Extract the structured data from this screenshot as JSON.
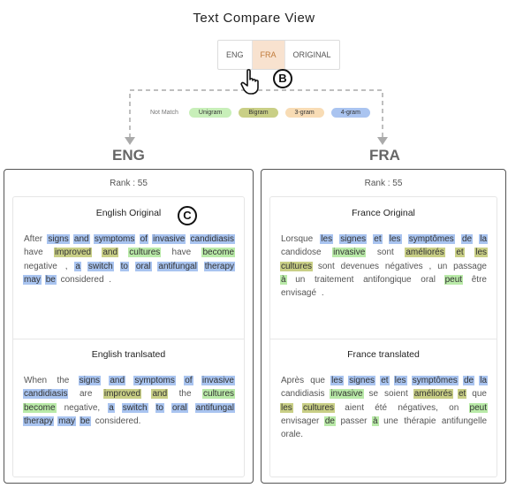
{
  "title": "Text Compare View",
  "tabs": [
    {
      "label": "ENG",
      "active": false
    },
    {
      "label": "FRA",
      "active": true
    },
    {
      "label": "ORIGINAL",
      "active": false
    }
  ],
  "annotations": {
    "b": "B",
    "c": "C"
  },
  "legend": {
    "not_match": "Not Match",
    "items": [
      {
        "label": "Unigram",
        "color": "#c8efb9"
      },
      {
        "label": "Bigram",
        "color": "#c9cf86"
      },
      {
        "label": "3-gram",
        "color": "#f8dcb5"
      },
      {
        "label": "4-gram",
        "color": "#aac4f0"
      }
    ]
  },
  "side_labels": {
    "eng": "ENG",
    "fra": "FRA"
  },
  "panels": {
    "eng": {
      "rank": "Rank : 55",
      "original_title": "English Original",
      "translated_title": "English tranlsated",
      "original": [
        [
          "After",
          ""
        ],
        [
          "signs",
          "u"
        ],
        [
          "and",
          "u"
        ],
        [
          "symptoms",
          "u"
        ],
        [
          "of",
          "u"
        ],
        [
          "invasive",
          "u"
        ],
        [
          "candidiasis",
          "u"
        ],
        [
          "have",
          ""
        ],
        [
          "improved",
          "b"
        ],
        [
          "and",
          "b"
        ],
        [
          "cultures",
          "g"
        ],
        [
          "have",
          ""
        ],
        [
          "become",
          "g"
        ],
        [
          "negative",
          ""
        ],
        [
          ",",
          ""
        ],
        [
          "a",
          "u"
        ],
        [
          "switch",
          "u"
        ],
        [
          "to",
          "u"
        ],
        [
          "oral",
          "u"
        ],
        [
          "antifungal",
          "u"
        ],
        [
          "therapy",
          "u"
        ],
        [
          "may",
          "u"
        ],
        [
          "be",
          "u"
        ],
        [
          "considered",
          ""
        ],
        [
          ".",
          ""
        ]
      ],
      "translated": [
        [
          "When",
          ""
        ],
        [
          "the",
          ""
        ],
        [
          "signs",
          "u"
        ],
        [
          "and",
          "u"
        ],
        [
          "symptoms",
          "u"
        ],
        [
          "of",
          "u"
        ],
        [
          "invasive",
          "u"
        ],
        [
          "candidiasis",
          "u"
        ],
        [
          "are",
          ""
        ],
        [
          "improved",
          "b"
        ],
        [
          "and",
          "b"
        ],
        [
          "the",
          ""
        ],
        [
          "cultures",
          "g"
        ],
        [
          "become",
          "g"
        ],
        [
          "negative,",
          ""
        ],
        [
          "a",
          "u"
        ],
        [
          "switch",
          "u"
        ],
        [
          "to",
          "u"
        ],
        [
          "oral",
          "u"
        ],
        [
          "antifungal",
          "u"
        ],
        [
          "therapy",
          "u"
        ],
        [
          "may",
          "u"
        ],
        [
          "be",
          "u"
        ],
        [
          "considered.",
          ""
        ]
      ]
    },
    "fra": {
      "rank": "Rank : 55",
      "original_title": "France Original",
      "translated_title": "France translated",
      "original": [
        [
          "Lorsque",
          ""
        ],
        [
          "les",
          "u"
        ],
        [
          "signes",
          "u"
        ],
        [
          "et",
          "u"
        ],
        [
          "les",
          "u"
        ],
        [
          "symptômes",
          "u"
        ],
        [
          "de",
          "u"
        ],
        [
          "la",
          "u"
        ],
        [
          "candidose",
          ""
        ],
        [
          "invasive",
          "g"
        ],
        [
          "sont",
          ""
        ],
        [
          "améliorés",
          "b"
        ],
        [
          "et",
          "b"
        ],
        [
          "les",
          "b"
        ],
        [
          "cultures",
          "b"
        ],
        [
          "sont",
          ""
        ],
        [
          "devenues",
          ""
        ],
        [
          "négatives",
          ""
        ],
        [
          ",",
          ""
        ],
        [
          "un",
          ""
        ],
        [
          "passage",
          ""
        ],
        [
          "à",
          "g"
        ],
        [
          "un",
          ""
        ],
        [
          "traitement",
          ""
        ],
        [
          "antifongique",
          ""
        ],
        [
          "oral",
          ""
        ],
        [
          "peut",
          "g"
        ],
        [
          "être",
          ""
        ],
        [
          "envisagé",
          ""
        ],
        [
          ".",
          ""
        ]
      ],
      "translated": [
        [
          "Après",
          ""
        ],
        [
          "que",
          ""
        ],
        [
          "les",
          "u"
        ],
        [
          "signes",
          "u"
        ],
        [
          "et",
          "u"
        ],
        [
          "les",
          "u"
        ],
        [
          "symptômes",
          "u"
        ],
        [
          "de",
          "u"
        ],
        [
          "la",
          "u"
        ],
        [
          "candidiasis",
          ""
        ],
        [
          "invasive",
          "g"
        ],
        [
          "se",
          ""
        ],
        [
          "soient",
          ""
        ],
        [
          "améliorés",
          "b"
        ],
        [
          "et",
          "b"
        ],
        [
          "que",
          ""
        ],
        [
          "les",
          "b"
        ],
        [
          "cultures",
          "b"
        ],
        [
          "aient",
          ""
        ],
        [
          "été",
          ""
        ],
        [
          "négatives,",
          ""
        ],
        [
          "on",
          ""
        ],
        [
          "peut",
          "g"
        ],
        [
          "envisager",
          ""
        ],
        [
          "de",
          "g"
        ],
        [
          "passer",
          ""
        ],
        [
          "à",
          "g"
        ],
        [
          "une",
          ""
        ],
        [
          "thérapie",
          ""
        ],
        [
          "antifungelle",
          ""
        ],
        [
          "orale.",
          ""
        ]
      ]
    }
  }
}
